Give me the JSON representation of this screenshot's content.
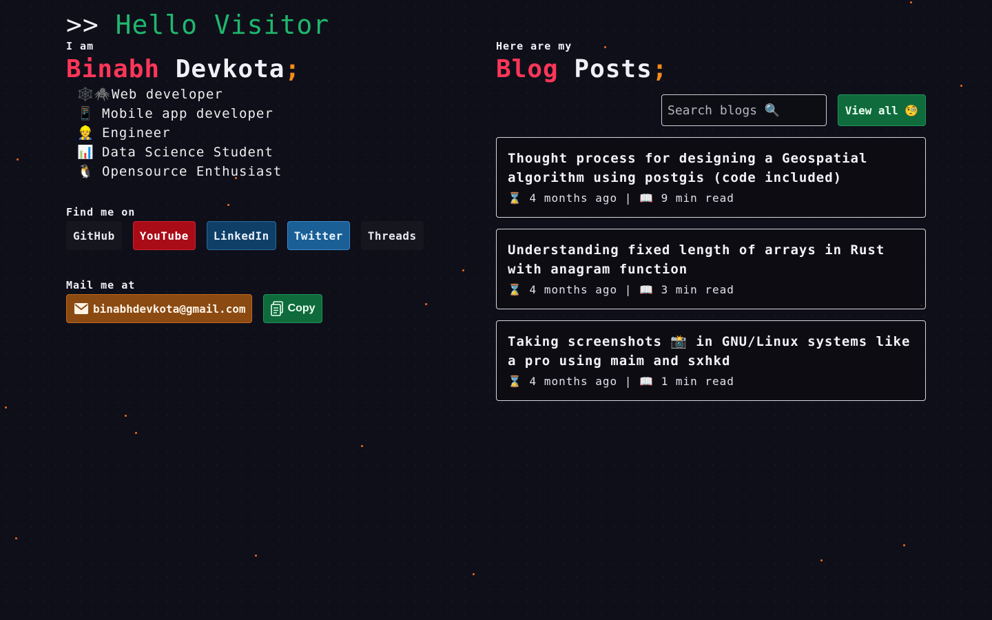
{
  "hello": {
    "prompt": ">>",
    "greeting": "Hello Visitor"
  },
  "intro": {
    "label": "I am",
    "first_name": "Binabh",
    "last_name": "Devkota",
    "suffix": ";"
  },
  "roles": [
    {
      "icon": "🕸️🕷️",
      "icon_name": "spider-web-icon",
      "label": "Web developer"
    },
    {
      "icon": "📱",
      "icon_name": "mobile-phone-icon",
      "label": "Mobile app developer"
    },
    {
      "icon": "👷",
      "icon_name": "construction-worker-icon",
      "label": "Engineer"
    },
    {
      "icon": "📊",
      "icon_name": "bar-chart-icon",
      "label": "Data Science Student"
    },
    {
      "icon": "🐧",
      "icon_name": "penguin-icon",
      "label": "Opensource Enthusiast"
    }
  ],
  "socials": {
    "label": "Find me on",
    "items": [
      "GitHub",
      "YouTube",
      "LinkedIn",
      "Twitter",
      "Threads"
    ]
  },
  "mail": {
    "label": "Mail me at",
    "email": "binabhdevkota@gmail.com",
    "copy_label": "Copy"
  },
  "blog": {
    "label": "Here are my",
    "title_first": "Blog",
    "title_last": "Posts",
    "suffix": ";",
    "search_placeholder": "Search blogs 🔍",
    "view_all_label": "View all 🧐",
    "posts": [
      {
        "title": "Thought process for designing a Geospatial algorithm using postgis (code included)",
        "meta": "⌛ 4 months ago | 📖 9 min read"
      },
      {
        "title": "Understanding fixed length of arrays in Rust with anagram function",
        "meta": "⌛ 4 months ago | 📖 3 min read"
      },
      {
        "title": "Taking screenshots 📸 in GNU/Linux systems like a pro using maim and sxhkd",
        "meta": "⌛ 4 months ago | 📖 1 min read"
      }
    ]
  },
  "colors": {
    "background": "#0f0f1a",
    "accent_red": "#ff3658",
    "accent_green": "#1fb86d",
    "accent_orange": "#f28c1b"
  }
}
